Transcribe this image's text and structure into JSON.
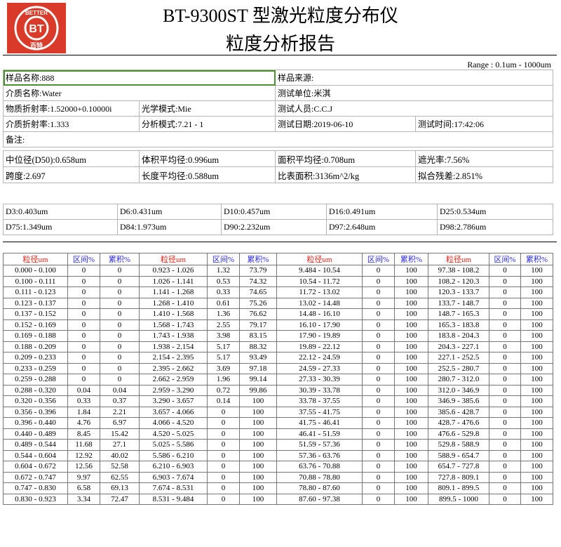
{
  "header": {
    "title": "BT-9300ST 型激光粒度分布仪",
    "subtitle": "粒度分析报告",
    "range": "Range : 0.1um - 1000um",
    "logo_text_top": "BETTER",
    "logo_text_center": "BT",
    "logo_text_bottom": "百特"
  },
  "info": {
    "sample_name": "样品名称:888",
    "sample_source": "样品来源:",
    "medium_name": "介质名称:Water",
    "test_unit": "测试单位:米淇",
    "refractive_index": "物质折射率:1.52000+0.10000i",
    "optical_mode": "光学模式:Mie",
    "tester": "测试人员:C.C.J",
    "medium_refractive_index": "介质折射率:1.333",
    "analysis_mode": "分析模式:7.21 - 1",
    "test_date": "测试日期:2019-06-10",
    "test_time": "测试时间:17:42:06",
    "remark": "备注:"
  },
  "stats": {
    "d50": "中位径(D50):0.658um",
    "volume_mean": "体积平均径:0.996um",
    "area_mean": "面积平均径:0.708um",
    "obscuration": "遮光率:7.56%",
    "span": "跨度:2.697",
    "length_mean": "长度平均径:0.588um",
    "specific_surface": "比表面积:3136m^2/kg",
    "fit_residual": "拟合残差:2.851%"
  },
  "percentiles": {
    "row1": [
      "D3:0.403um",
      "D6:0.431um",
      "D10:0.457um",
      "D16:0.491um",
      "D25:0.534um"
    ],
    "row2": [
      "D75:1.349um",
      "D84:1.973um",
      "D90:2.232um",
      "D97:2.648um",
      "D98:2.786um"
    ]
  },
  "table": {
    "headers": [
      "粒径um",
      "区间%",
      "累积%"
    ],
    "rows": [
      [
        "0.000 - 0.100",
        "0",
        "0",
        "0.923 - 1.026",
        "1.32",
        "73.79",
        "9.484 - 10.54",
        "0",
        "100",
        "97.38 - 108.2",
        "0",
        "100"
      ],
      [
        "0.100 - 0.111",
        "0",
        "0",
        "1.026 - 1.141",
        "0.53",
        "74.32",
        "10.54 - 11.72",
        "0",
        "100",
        "108.2 - 120.3",
        "0",
        "100"
      ],
      [
        "0.111 - 0.123",
        "0",
        "0",
        "1.141 - 1.268",
        "0.33",
        "74.65",
        "11.72 - 13.02",
        "0",
        "100",
        "120.3 - 133.7",
        "0",
        "100"
      ],
      [
        "0.123 - 0.137",
        "0",
        "0",
        "1.268 - 1.410",
        "0.61",
        "75.26",
        "13.02 - 14.48",
        "0",
        "100",
        "133.7 - 148.7",
        "0",
        "100"
      ],
      [
        "0.137 - 0.152",
        "0",
        "0",
        "1.410 - 1.568",
        "1.36",
        "76.62",
        "14.48 - 16.10",
        "0",
        "100",
        "148.7 - 165.3",
        "0",
        "100"
      ],
      [
        "0.152 - 0.169",
        "0",
        "0",
        "1.568 - 1.743",
        "2.55",
        "79.17",
        "16.10 - 17.90",
        "0",
        "100",
        "165.3 - 183.8",
        "0",
        "100"
      ],
      [
        "0.169 - 0.188",
        "0",
        "0",
        "1.743 - 1.938",
        "3.98",
        "83.15",
        "17.90 - 19.89",
        "0",
        "100",
        "183.8 - 204.3",
        "0",
        "100"
      ],
      [
        "0.188 - 0.209",
        "0",
        "0",
        "1.938 - 2.154",
        "5.17",
        "88.32",
        "19.89 - 22.12",
        "0",
        "100",
        "204.3 - 227.1",
        "0",
        "100"
      ],
      [
        "0.209 - 0.233",
        "0",
        "0",
        "2.154 - 2.395",
        "5.17",
        "93.49",
        "22.12 - 24.59",
        "0",
        "100",
        "227.1 - 252.5",
        "0",
        "100"
      ],
      [
        "0.233 - 0.259",
        "0",
        "0",
        "2.395 - 2.662",
        "3.69",
        "97.18",
        "24.59 - 27.33",
        "0",
        "100",
        "252.5 - 280.7",
        "0",
        "100"
      ],
      [
        "0.259 - 0.288",
        "0",
        "0",
        "2.662 - 2.959",
        "1.96",
        "99.14",
        "27.33 - 30.39",
        "0",
        "100",
        "280.7 - 312.0",
        "0",
        "100"
      ],
      [
        "0.288 - 0.320",
        "0.04",
        "0.04",
        "2.959 - 3.290",
        "0.72",
        "99.86",
        "30.39 - 33.78",
        "0",
        "100",
        "312.0 - 346.9",
        "0",
        "100"
      ],
      [
        "0.320 - 0.356",
        "0.33",
        "0.37",
        "3.290 - 3.657",
        "0.14",
        "100",
        "33.78 - 37.55",
        "0",
        "100",
        "346.9 - 385.6",
        "0",
        "100"
      ],
      [
        "0.356 - 0.396",
        "1.84",
        "2.21",
        "3.657 - 4.066",
        "0",
        "100",
        "37.55 - 41.75",
        "0",
        "100",
        "385.6 - 428.7",
        "0",
        "100"
      ],
      [
        "0.396 - 0.440",
        "4.76",
        "6.97",
        "4.066 - 4.520",
        "0",
        "100",
        "41.75 - 46.41",
        "0",
        "100",
        "428.7 - 476.6",
        "0",
        "100"
      ],
      [
        "0.440 - 0.489",
        "8.45",
        "15.42",
        "4.520 - 5.025",
        "0",
        "100",
        "46.41 - 51.59",
        "0",
        "100",
        "476.6 - 529.8",
        "0",
        "100"
      ],
      [
        "0.489 - 0.544",
        "11.68",
        "27.1",
        "5.025 - 5.586",
        "0",
        "100",
        "51.59 - 57.36",
        "0",
        "100",
        "529.8 - 588.9",
        "0",
        "100"
      ],
      [
        "0.544 - 0.604",
        "12.92",
        "40.02",
        "5.586 - 6.210",
        "0",
        "100",
        "57.36 - 63.76",
        "0",
        "100",
        "588.9 - 654.7",
        "0",
        "100"
      ],
      [
        "0.604 - 0.672",
        "12.56",
        "52.58",
        "6.210 - 6.903",
        "0",
        "100",
        "63.76 - 70.88",
        "0",
        "100",
        "654.7 - 727.8",
        "0",
        "100"
      ],
      [
        "0.672 - 0.747",
        "9.97",
        "62.55",
        "6.903 - 7.674",
        "0",
        "100",
        "70.88 - 78.80",
        "0",
        "100",
        "727.8 - 809.1",
        "0",
        "100"
      ],
      [
        "0.747 - 0.830",
        "6.58",
        "69.13",
        "7.674 - 8.531",
        "0",
        "100",
        "78.80 - 87.60",
        "0",
        "100",
        "809.1 - 899.5",
        "0",
        "100"
      ],
      [
        "0.830 - 0.923",
        "3.34",
        "72.47",
        "8.531 - 9.484",
        "0",
        "100",
        "87.60 - 97.38",
        "0",
        "100",
        "899.5 - 1000",
        "0",
        "100"
      ]
    ]
  }
}
